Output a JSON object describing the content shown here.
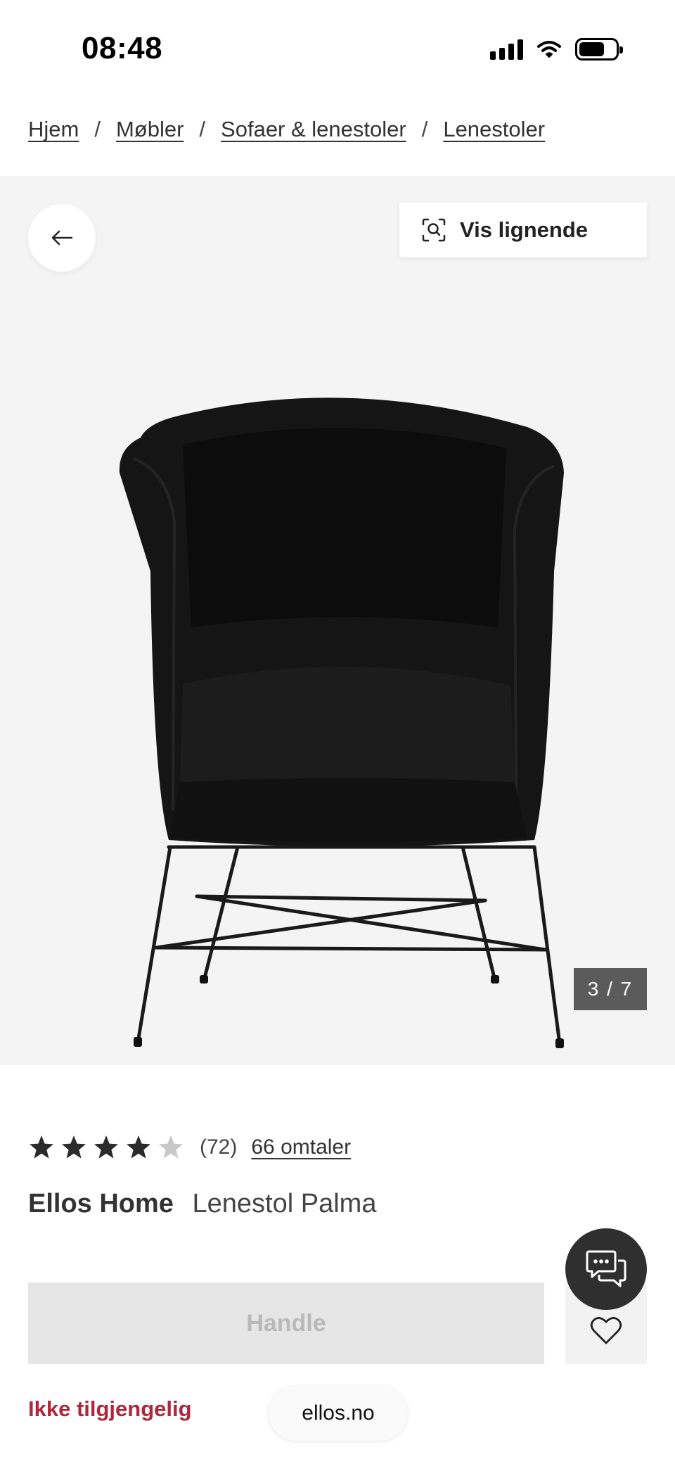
{
  "status_bar": {
    "time": "08:48",
    "battery_level": 0.7
  },
  "breadcrumb": {
    "items": [
      "Hjem",
      "Møbler",
      "Sofaer & lenestoler",
      "Lenestoler"
    ],
    "separator": "/"
  },
  "gallery": {
    "back_icon": "arrow-left-icon",
    "similar_icon": "visual-search-icon",
    "similar_label": "Vis lignende",
    "counter": "3 / 7",
    "current_image": 3,
    "total_images": 7
  },
  "product": {
    "rating": 4,
    "rating_max": 5,
    "review_count": "(72)",
    "reviews_link": "66 omtaler",
    "brand": "Ellos Home",
    "name": "Lenestol Palma",
    "buy_label": "Handle",
    "availability": "Ikke tilgjengelig"
  },
  "footer": {
    "domain": "ellos.no"
  },
  "icons": {
    "favorite": "heart-icon",
    "chat": "chat-icon"
  },
  "colors": {
    "accent_unavailable": "#b0263a",
    "gallery_bg": "#f4f4f4",
    "disabled_button": "#e6e6e6"
  }
}
